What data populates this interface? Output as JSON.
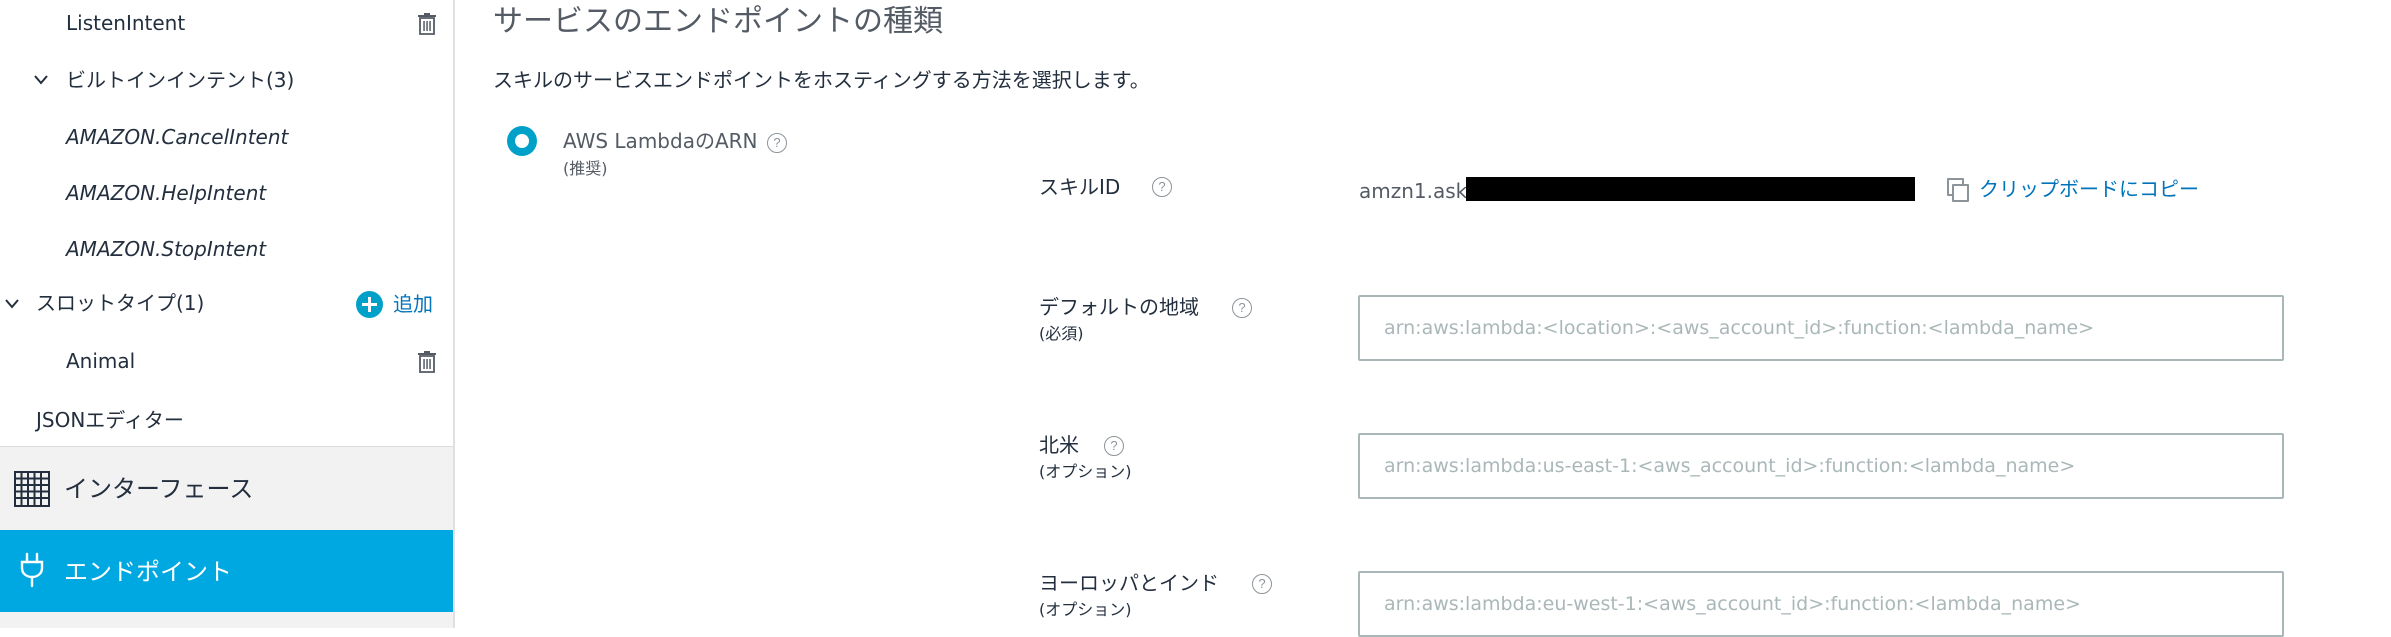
{
  "sidebar": {
    "intents": [
      {
        "label": "ListenIntent"
      }
    ],
    "builtin_group": {
      "label": "ビルトインインテント(3)"
    },
    "builtin_intents": [
      {
        "label": "AMAZON.CancelIntent"
      },
      {
        "label": "AMAZON.HelpIntent"
      },
      {
        "label": "AMAZON.StopIntent"
      }
    ],
    "slot_types_group": {
      "label": "スロットタイプ(1)",
      "add_label": "追加"
    },
    "slot_types": [
      {
        "label": "Animal"
      }
    ],
    "json_editor": {
      "label": "JSONエディター"
    },
    "nav": {
      "interface": {
        "label": "インターフェース"
      },
      "endpoint": {
        "label": "エンドポイント"
      }
    }
  },
  "main": {
    "title": "サービスのエンドポイントの種類",
    "description": "スキルのサービスエンドポイントをホスティングする方法を選択します。",
    "option": {
      "label": "AWS LambdaのARN",
      "sublabel": "(推奨)",
      "selected": true
    },
    "skill_id": {
      "label": "スキルID",
      "value_prefix": "amzn1.ask.",
      "copy_label": "クリップボードにコピー"
    },
    "fields": [
      {
        "label": "デフォルトの地域",
        "sublabel": "(必須)",
        "value": "",
        "placeholder": "arn:aws:lambda:<location>:<aws_account_id>:function:<lambda_name>"
      },
      {
        "label": "北米",
        "sublabel": "(オプション)",
        "value": "",
        "placeholder": "arn:aws:lambda:us-east-1:<aws_account_id>:function:<lambda_name>"
      },
      {
        "label": "ヨーロッパとインド",
        "sublabel": "(オプション)",
        "value": "",
        "placeholder": "arn:aws:lambda:eu-west-1:<aws_account_id>:function:<lambda_name>"
      }
    ],
    "help_glyph": "?"
  },
  "colors": {
    "accent": "#00a8e1",
    "link": "#0073bb",
    "text": "#232f3e",
    "muted": "#545b64"
  }
}
